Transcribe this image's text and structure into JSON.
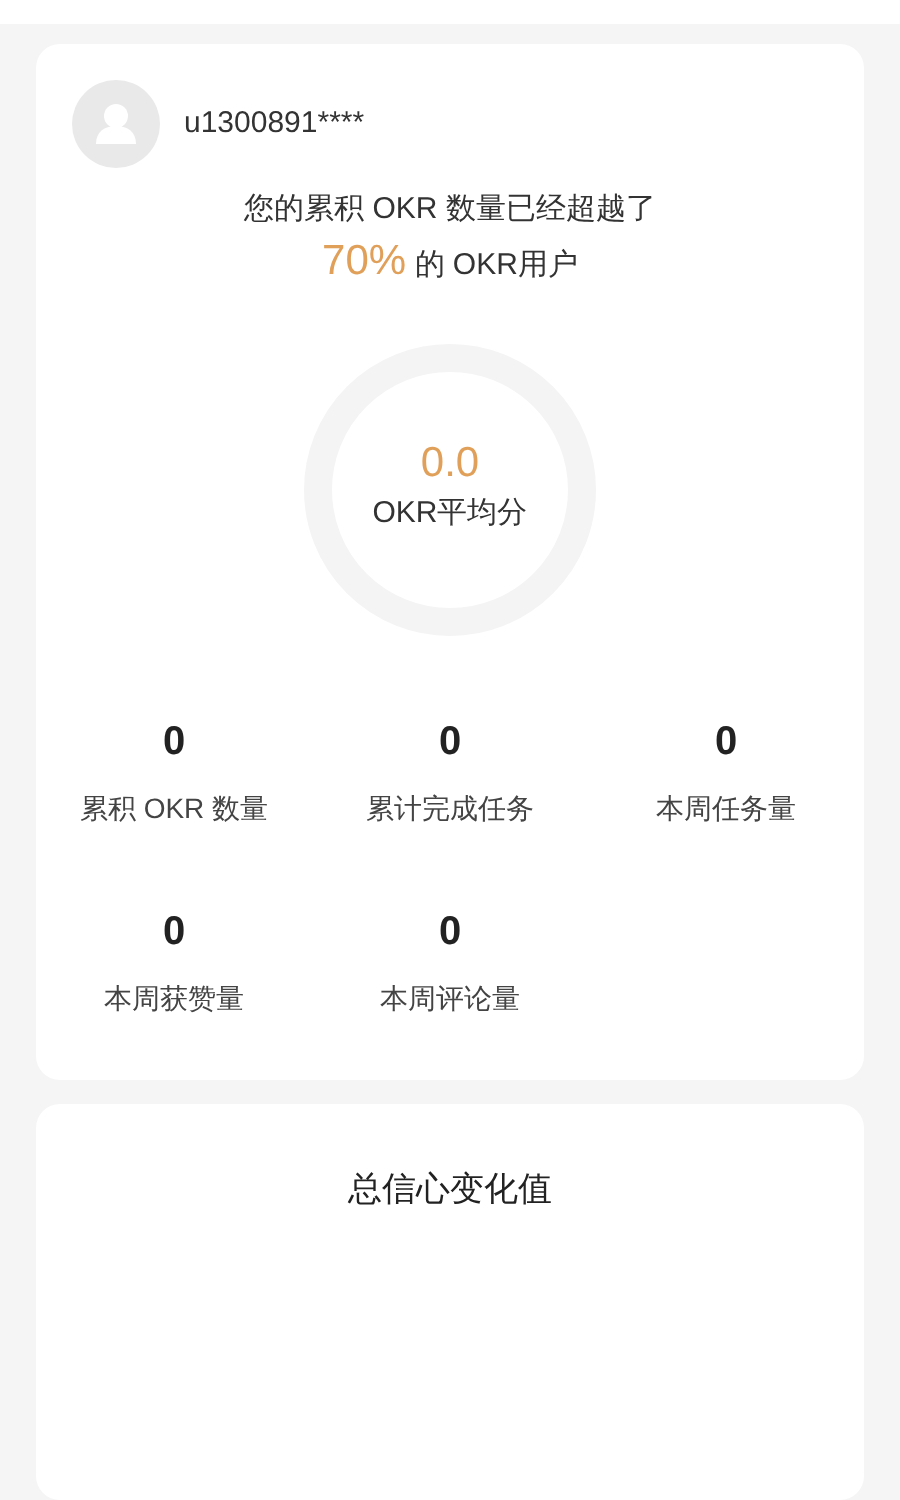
{
  "profile": {
    "username": "u1300891****"
  },
  "summary": {
    "line1": "您的累积 OKR 数量已经超越了",
    "percent": "70%",
    "line2": "的 OKR用户"
  },
  "score": {
    "value": "0.0",
    "label": "OKR平均分",
    "level": 0
  },
  "stats": [
    {
      "value": "0",
      "label": "累积 OKR 数量"
    },
    {
      "value": "0",
      "label": "累计完成任务"
    },
    {
      "value": "0",
      "label": "本周任务量"
    },
    {
      "value": "0",
      "label": "本周获赞量"
    },
    {
      "value": "0",
      "label": "本周评论量"
    }
  ],
  "confidence": {
    "title": "总信心变化值"
  }
}
